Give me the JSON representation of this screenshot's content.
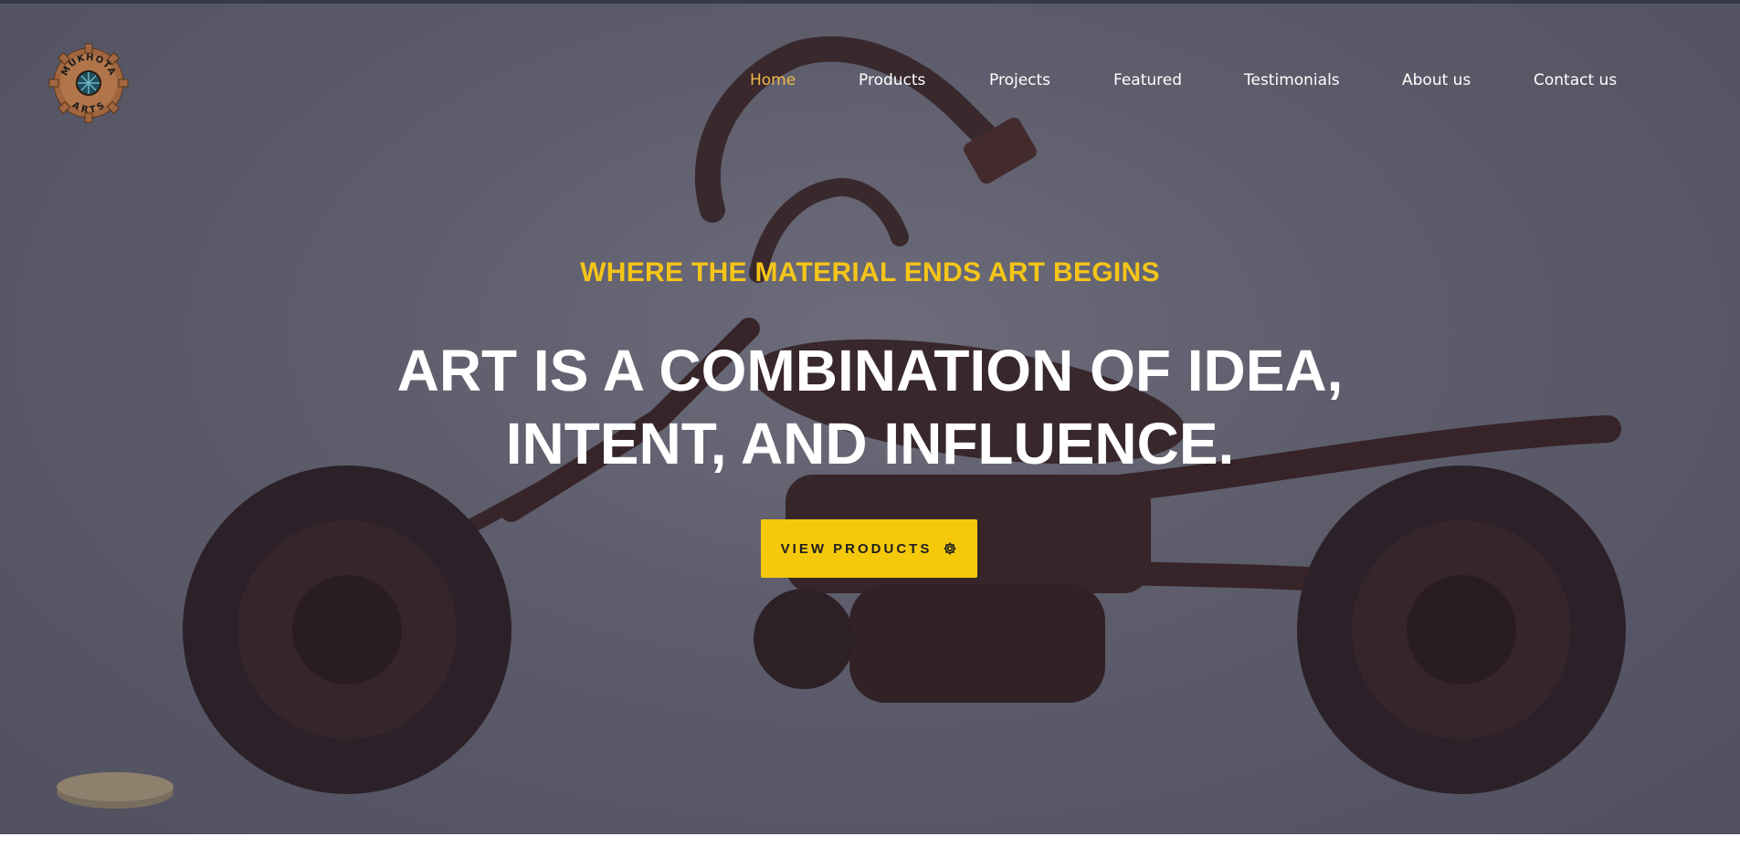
{
  "brand": {
    "logo_text_top": "MUKHOTA",
    "logo_text_bottom": "ARTS"
  },
  "nav": {
    "items": [
      {
        "label": "Home",
        "active": true
      },
      {
        "label": "Products",
        "active": false
      },
      {
        "label": "Projects",
        "active": false
      },
      {
        "label": "Featured",
        "active": false
      },
      {
        "label": "Testimonials",
        "active": false
      },
      {
        "label": "About us",
        "active": false
      },
      {
        "label": "Contact us",
        "active": false
      }
    ]
  },
  "hero": {
    "tagline": "WHERE THE MATERIAL ENDS ART BEGINS",
    "headline_line1": "ART IS A COMBINATION OF IDEA,",
    "headline_line2": "INTENT, AND INFLUENCE.",
    "cta_label": "VIEW PRODUCTS",
    "cta_icon": "gear-icon"
  },
  "colors": {
    "accent": "#f5c90b",
    "nav_active": "#f2b847",
    "text_light": "#ffffff"
  }
}
